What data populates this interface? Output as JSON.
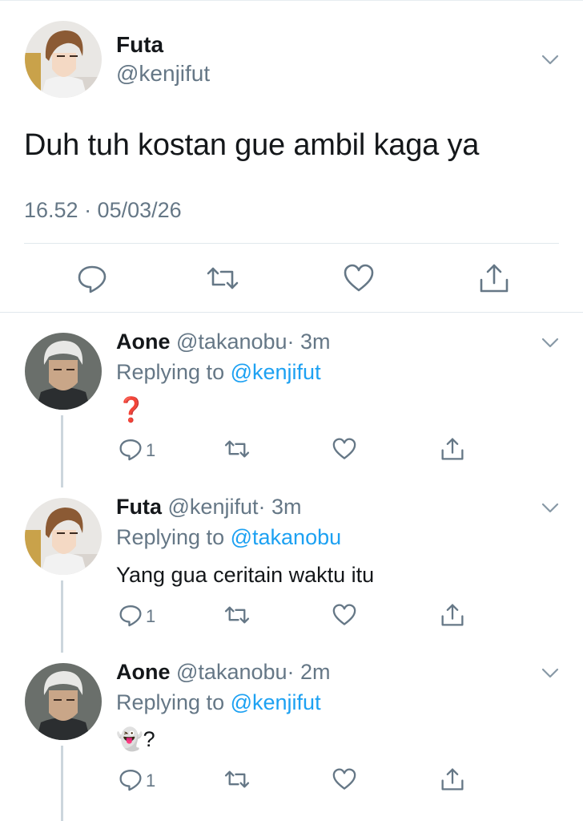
{
  "main_tweet": {
    "author_name": "Futa",
    "author_handle": "@kenjifut",
    "text": "Duh tuh kostan gue ambil kaga ya",
    "timestamp": "16.52 · 05/03/26"
  },
  "replies": [
    {
      "author_name": "Aone",
      "author_handle": "@takanobu",
      "time": "· 3m",
      "replying_prefix": "Replying to",
      "replying_to": "@kenjifut",
      "text": "❓",
      "reply_count": "1"
    },
    {
      "author_name": "Futa",
      "author_handle": "@kenjifut",
      "time": "· 3m",
      "replying_prefix": "Replying to",
      "replying_to": "@takanobu",
      "text": "Yang gua ceritain waktu itu",
      "reply_count": "1"
    },
    {
      "author_name": "Aone",
      "author_handle": "@takanobu",
      "time": "· 2m",
      "replying_prefix": "Replying to",
      "replying_to": "@kenjifut",
      "text": "👻?",
      "reply_count": "1"
    }
  ],
  "icons": {
    "reply": "reply-icon",
    "retweet": "retweet-icon",
    "like": "heart-icon",
    "share": "share-icon",
    "more": "chevron-down-icon"
  },
  "colors": {
    "link": "#1da1f2",
    "secondary_text": "#657786",
    "icon": "#657786",
    "divider": "#e1e8ed",
    "thread_line": "#ccd6dd"
  }
}
